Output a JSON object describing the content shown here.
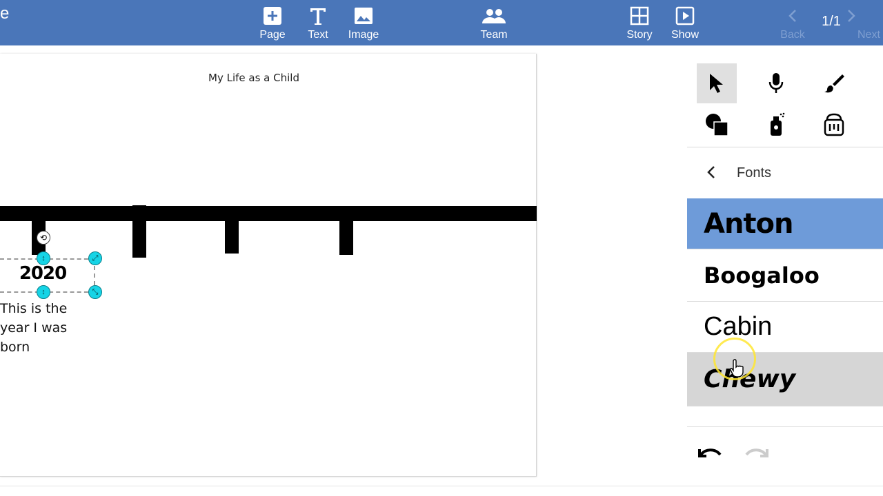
{
  "toolbar": {
    "brand_fragment": "e",
    "buttons": [
      {
        "label": "Page",
        "icon": "add-page-icon"
      },
      {
        "label": "Text",
        "icon": "text-icon"
      },
      {
        "label": "Image",
        "icon": "image-icon"
      },
      {
        "label": "Team",
        "icon": "team-icon"
      },
      {
        "label": "Story",
        "icon": "story-grid-icon"
      },
      {
        "label": "Show",
        "icon": "show-play-icon"
      },
      {
        "label": "Back",
        "icon": "chevron-left-icon"
      },
      {
        "label": "Next",
        "icon": "chevron-right-icon"
      }
    ],
    "page_indicator": "1/1"
  },
  "page": {
    "title": "My Life as a Child",
    "year_label": "2020",
    "caption": "This is the year I was born"
  },
  "panel": {
    "tools": [
      "pointer-icon",
      "microphone-icon",
      "brush-icon",
      "shapes-icon",
      "spray-paint-icon",
      "paint-bucket-icon"
    ],
    "fonts_header": "Fonts",
    "fonts": [
      {
        "name": "Anton",
        "state": "selected"
      },
      {
        "name": "Boogaloo",
        "state": "normal"
      },
      {
        "name": "Cabin",
        "state": "normal"
      },
      {
        "name": "Chewy",
        "state": "hover"
      }
    ]
  },
  "colors": {
    "toolbar_bg": "#4a76b9",
    "selected_font_bg": "#6e9bd9",
    "hover_font_bg": "#d6d6d6",
    "handle": "#16d4e6"
  }
}
